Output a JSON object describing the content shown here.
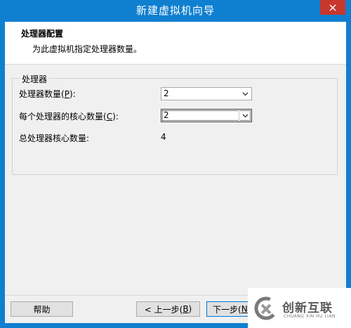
{
  "window": {
    "title": "新建虚拟机向导"
  },
  "header": {
    "title": "处理器配置",
    "subtitle": "为此虚拟机指定处理器数量。"
  },
  "group": {
    "legend": "处理器",
    "rows": [
      {
        "label_pre": "处理器数量(",
        "accel": "P",
        "label_post": "):",
        "value": "2"
      },
      {
        "label_pre": "每个处理器的核心数量(",
        "accel": "C",
        "label_post": "):",
        "value": "2"
      },
      {
        "label": "总处理器核心数量:",
        "value": "4"
      }
    ]
  },
  "buttons": {
    "help": "帮助",
    "back_pre": "< 上一步(",
    "back_accel": "B",
    "back_post": ")",
    "next_pre": "下一步(",
    "next_accel": "N"
  },
  "watermark": {
    "brand": "创新互联",
    "pinyin": "CHUANG XIN HU LIAN"
  },
  "icons": {
    "close": "close-icon",
    "dropdown": "chevron-down-icon",
    "logo": "brand-logo-icon"
  },
  "colors": {
    "titlebar": "#0f7fd0",
    "close": "#c7372c",
    "button_border_default": "#0078d7"
  }
}
